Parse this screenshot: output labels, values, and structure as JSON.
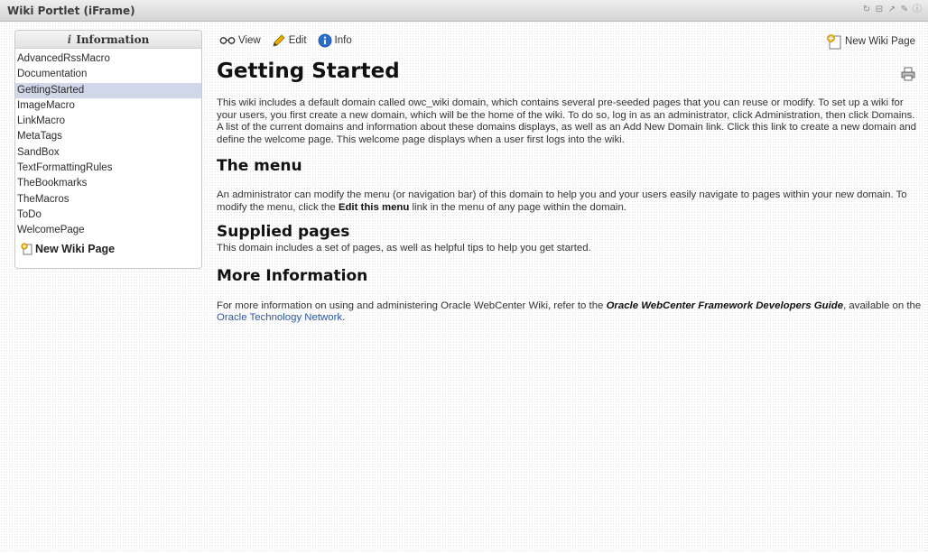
{
  "window": {
    "title": "Wiki Portlet (iFrame)",
    "controls": [
      "refresh-icon",
      "minimize-icon",
      "popout-icon",
      "edit-icon",
      "help-icon"
    ]
  },
  "sidebar": {
    "heading": "Information",
    "items": [
      {
        "label": "AdvancedRssMacro",
        "active": false
      },
      {
        "label": "Documentation",
        "active": false
      },
      {
        "label": "GettingStarted",
        "active": true
      },
      {
        "label": "ImageMacro",
        "active": false
      },
      {
        "label": "LinkMacro",
        "active": false
      },
      {
        "label": "MetaTags",
        "active": false
      },
      {
        "label": "SandBox",
        "active": false
      },
      {
        "label": "TextFormattingRules",
        "active": false
      },
      {
        "label": "TheBookmarks",
        "active": false
      },
      {
        "label": "TheMacros",
        "active": false
      },
      {
        "label": "ToDo",
        "active": false
      },
      {
        "label": "WelcomePage",
        "active": false
      }
    ],
    "new_page": "New Wiki Page"
  },
  "toolbar": {
    "view": "View",
    "edit": "Edit",
    "info": "Info",
    "new_page": "New Wiki Page"
  },
  "page": {
    "title": "Getting Started",
    "intro": "This wiki includes a default domain called owc_wiki domain, which contains several pre-seeded pages that you can reuse or modify. To set up a wiki for your users, you first create a new domain, which will be the home of the wiki. To do so, log in as an administrator, click Administration, then click Domains. A list of the current domains and information about these domains displays, as well as an Add New Domain link. Click this link to create a new domain and define the welcome page. This welcome page displays when a user first logs into the wiki.",
    "menu_heading": "The menu",
    "menu_text_before": "An administrator can modify the menu (or navigation bar) of this domain to help you and your users easily navigate to pages within your new domain. To modify the menu, click the ",
    "menu_bold": "Edit this menu",
    "menu_text_after": " link in the menu of any page within the domain.",
    "supplied_heading": "Supplied pages",
    "supplied_text": "This domain includes a set of pages, as well as helpful tips to help you get started.",
    "more_heading": "More Information",
    "more_text_before": "For more information on using and administering Oracle WebCenter Wiki, refer to the ",
    "more_guide": "Oracle WebCenter Framework Developers Guide",
    "more_text_mid": ", available on the ",
    "more_link": "Oracle Technology Network",
    "more_text_end": "."
  },
  "colors": {
    "active_item_bg": "#cfd7e8",
    "link": "#2d57a0",
    "info_icon": "#2a6fd0",
    "edit_pencil": "#e0a400"
  }
}
